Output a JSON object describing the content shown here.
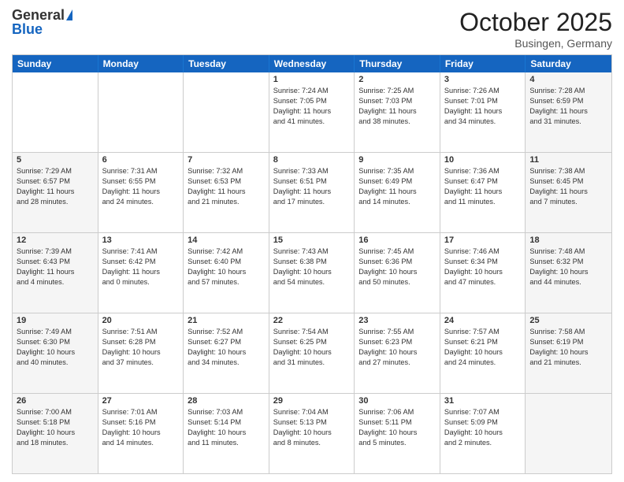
{
  "header": {
    "logo_general": "General",
    "logo_blue": "Blue",
    "month": "October 2025",
    "location": "Busingen, Germany"
  },
  "days_of_week": [
    "Sunday",
    "Monday",
    "Tuesday",
    "Wednesday",
    "Thursday",
    "Friday",
    "Saturday"
  ],
  "rows": [
    [
      {
        "day": "",
        "lines": [],
        "shaded": false
      },
      {
        "day": "",
        "lines": [],
        "shaded": false
      },
      {
        "day": "",
        "lines": [],
        "shaded": false
      },
      {
        "day": "1",
        "lines": [
          "Sunrise: 7:24 AM",
          "Sunset: 7:05 PM",
          "Daylight: 11 hours",
          "and 41 minutes."
        ],
        "shaded": false
      },
      {
        "day": "2",
        "lines": [
          "Sunrise: 7:25 AM",
          "Sunset: 7:03 PM",
          "Daylight: 11 hours",
          "and 38 minutes."
        ],
        "shaded": false
      },
      {
        "day": "3",
        "lines": [
          "Sunrise: 7:26 AM",
          "Sunset: 7:01 PM",
          "Daylight: 11 hours",
          "and 34 minutes."
        ],
        "shaded": false
      },
      {
        "day": "4",
        "lines": [
          "Sunrise: 7:28 AM",
          "Sunset: 6:59 PM",
          "Daylight: 11 hours",
          "and 31 minutes."
        ],
        "shaded": true
      }
    ],
    [
      {
        "day": "5",
        "lines": [
          "Sunrise: 7:29 AM",
          "Sunset: 6:57 PM",
          "Daylight: 11 hours",
          "and 28 minutes."
        ],
        "shaded": true
      },
      {
        "day": "6",
        "lines": [
          "Sunrise: 7:31 AM",
          "Sunset: 6:55 PM",
          "Daylight: 11 hours",
          "and 24 minutes."
        ],
        "shaded": false
      },
      {
        "day": "7",
        "lines": [
          "Sunrise: 7:32 AM",
          "Sunset: 6:53 PM",
          "Daylight: 11 hours",
          "and 21 minutes."
        ],
        "shaded": false
      },
      {
        "day": "8",
        "lines": [
          "Sunrise: 7:33 AM",
          "Sunset: 6:51 PM",
          "Daylight: 11 hours",
          "and 17 minutes."
        ],
        "shaded": false
      },
      {
        "day": "9",
        "lines": [
          "Sunrise: 7:35 AM",
          "Sunset: 6:49 PM",
          "Daylight: 11 hours",
          "and 14 minutes."
        ],
        "shaded": false
      },
      {
        "day": "10",
        "lines": [
          "Sunrise: 7:36 AM",
          "Sunset: 6:47 PM",
          "Daylight: 11 hours",
          "and 11 minutes."
        ],
        "shaded": false
      },
      {
        "day": "11",
        "lines": [
          "Sunrise: 7:38 AM",
          "Sunset: 6:45 PM",
          "Daylight: 11 hours",
          "and 7 minutes."
        ],
        "shaded": true
      }
    ],
    [
      {
        "day": "12",
        "lines": [
          "Sunrise: 7:39 AM",
          "Sunset: 6:43 PM",
          "Daylight: 11 hours",
          "and 4 minutes."
        ],
        "shaded": true
      },
      {
        "day": "13",
        "lines": [
          "Sunrise: 7:41 AM",
          "Sunset: 6:42 PM",
          "Daylight: 11 hours",
          "and 0 minutes."
        ],
        "shaded": false
      },
      {
        "day": "14",
        "lines": [
          "Sunrise: 7:42 AM",
          "Sunset: 6:40 PM",
          "Daylight: 10 hours",
          "and 57 minutes."
        ],
        "shaded": false
      },
      {
        "day": "15",
        "lines": [
          "Sunrise: 7:43 AM",
          "Sunset: 6:38 PM",
          "Daylight: 10 hours",
          "and 54 minutes."
        ],
        "shaded": false
      },
      {
        "day": "16",
        "lines": [
          "Sunrise: 7:45 AM",
          "Sunset: 6:36 PM",
          "Daylight: 10 hours",
          "and 50 minutes."
        ],
        "shaded": false
      },
      {
        "day": "17",
        "lines": [
          "Sunrise: 7:46 AM",
          "Sunset: 6:34 PM",
          "Daylight: 10 hours",
          "and 47 minutes."
        ],
        "shaded": false
      },
      {
        "day": "18",
        "lines": [
          "Sunrise: 7:48 AM",
          "Sunset: 6:32 PM",
          "Daylight: 10 hours",
          "and 44 minutes."
        ],
        "shaded": true
      }
    ],
    [
      {
        "day": "19",
        "lines": [
          "Sunrise: 7:49 AM",
          "Sunset: 6:30 PM",
          "Daylight: 10 hours",
          "and 40 minutes."
        ],
        "shaded": true
      },
      {
        "day": "20",
        "lines": [
          "Sunrise: 7:51 AM",
          "Sunset: 6:28 PM",
          "Daylight: 10 hours",
          "and 37 minutes."
        ],
        "shaded": false
      },
      {
        "day": "21",
        "lines": [
          "Sunrise: 7:52 AM",
          "Sunset: 6:27 PM",
          "Daylight: 10 hours",
          "and 34 minutes."
        ],
        "shaded": false
      },
      {
        "day": "22",
        "lines": [
          "Sunrise: 7:54 AM",
          "Sunset: 6:25 PM",
          "Daylight: 10 hours",
          "and 31 minutes."
        ],
        "shaded": false
      },
      {
        "day": "23",
        "lines": [
          "Sunrise: 7:55 AM",
          "Sunset: 6:23 PM",
          "Daylight: 10 hours",
          "and 27 minutes."
        ],
        "shaded": false
      },
      {
        "day": "24",
        "lines": [
          "Sunrise: 7:57 AM",
          "Sunset: 6:21 PM",
          "Daylight: 10 hours",
          "and 24 minutes."
        ],
        "shaded": false
      },
      {
        "day": "25",
        "lines": [
          "Sunrise: 7:58 AM",
          "Sunset: 6:19 PM",
          "Daylight: 10 hours",
          "and 21 minutes."
        ],
        "shaded": true
      }
    ],
    [
      {
        "day": "26",
        "lines": [
          "Sunrise: 7:00 AM",
          "Sunset: 5:18 PM",
          "Daylight: 10 hours",
          "and 18 minutes."
        ],
        "shaded": true
      },
      {
        "day": "27",
        "lines": [
          "Sunrise: 7:01 AM",
          "Sunset: 5:16 PM",
          "Daylight: 10 hours",
          "and 14 minutes."
        ],
        "shaded": false
      },
      {
        "day": "28",
        "lines": [
          "Sunrise: 7:03 AM",
          "Sunset: 5:14 PM",
          "Daylight: 10 hours",
          "and 11 minutes."
        ],
        "shaded": false
      },
      {
        "day": "29",
        "lines": [
          "Sunrise: 7:04 AM",
          "Sunset: 5:13 PM",
          "Daylight: 10 hours",
          "and 8 minutes."
        ],
        "shaded": false
      },
      {
        "day": "30",
        "lines": [
          "Sunrise: 7:06 AM",
          "Sunset: 5:11 PM",
          "Daylight: 10 hours",
          "and 5 minutes."
        ],
        "shaded": false
      },
      {
        "day": "31",
        "lines": [
          "Sunrise: 7:07 AM",
          "Sunset: 5:09 PM",
          "Daylight: 10 hours",
          "and 2 minutes."
        ],
        "shaded": false
      },
      {
        "day": "",
        "lines": [],
        "shaded": true
      }
    ]
  ]
}
